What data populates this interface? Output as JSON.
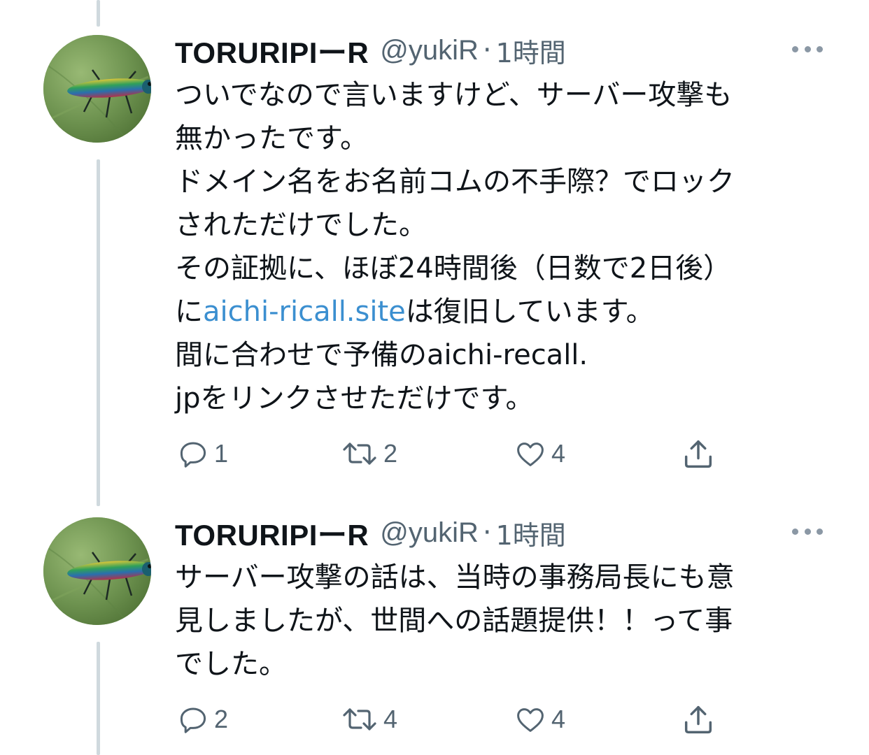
{
  "tweets": [
    {
      "name": "TORURIPIーR",
      "handle": "@yukiR",
      "separator": "·",
      "time": "1時間",
      "lines": [
        {
          "pre": "ついでなので言いますけど、サーバー攻撃も",
          "link": "",
          "post": ""
        },
        {
          "pre": "無かったです。",
          "link": "",
          "post": ""
        },
        {
          "pre": "ドメイン名をお名前コムの不手際？でロック",
          "link": "",
          "post": ""
        },
        {
          "pre": "されただけでした。",
          "link": "",
          "post": ""
        },
        {
          "pre": "その証拠に、ほぼ24時間後（日数で2日後）",
          "link": "",
          "post": ""
        },
        {
          "pre": "に",
          "link": "aichi-ricall.site",
          "post": "は復旧しています。"
        },
        {
          "pre": "間に合わせで予備のaichi-recall.",
          "link": "",
          "post": ""
        },
        {
          "pre": "jpをリンクさせただけです。",
          "link": "",
          "post": ""
        }
      ],
      "reply_count": "1",
      "retweet_count": "2",
      "like_count": "4"
    },
    {
      "name": "TORURIPIーR",
      "handle": "@yukiR",
      "separator": "·",
      "time": "1時間",
      "lines": [
        {
          "pre": "サーバー攻撃の話は、当時の事務局長にも意",
          "link": "",
          "post": ""
        },
        {
          "pre": "見しましたが、世間への話題提供！！って事",
          "link": "",
          "post": ""
        },
        {
          "pre": "でした。",
          "link": "",
          "post": ""
        }
      ],
      "reply_count": "2",
      "retweet_count": "4",
      "like_count": "4"
    }
  ],
  "icons": {
    "avatar": "jewel-beetle-avatar",
    "more": "more-horizontal-icon",
    "reply": "reply-icon",
    "retweet": "retweet-icon",
    "like": "heart-icon",
    "share": "share-icon"
  },
  "colors": {
    "text": "#0f1419",
    "secondary": "#536471",
    "link": "#3b8fd0",
    "thread_line": "#cfd9de"
  }
}
